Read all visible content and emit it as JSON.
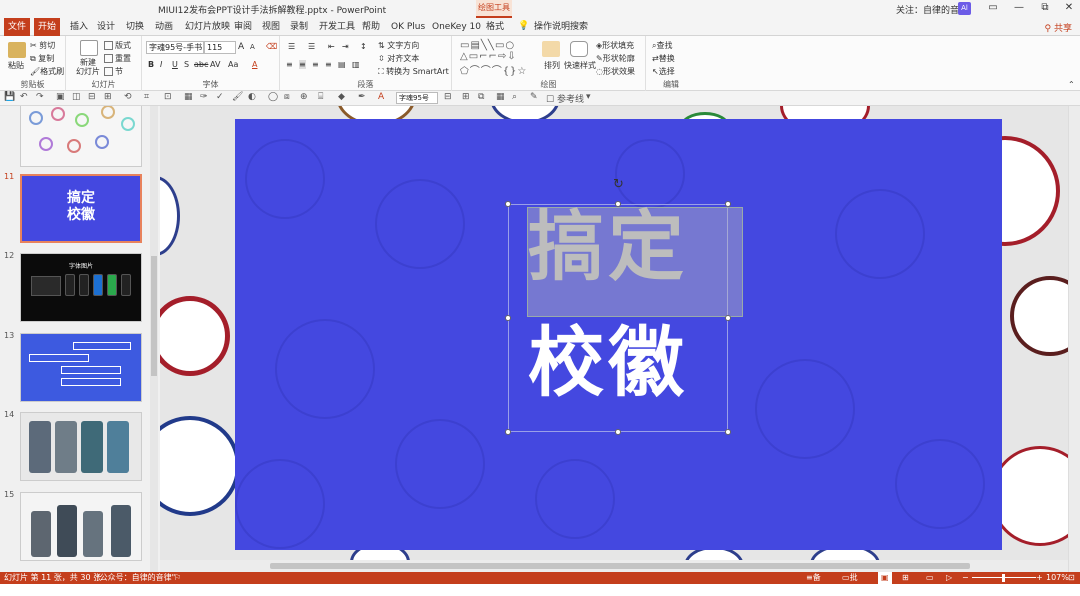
{
  "window": {
    "title": "MIUI12发布会PPT设计手法拆解教程.pptx  -  PowerPoint",
    "context_tab_group": "绘图工具",
    "follow_text": "关注：自律的音律",
    "avatar_text": "Al",
    "win_minimize": "—",
    "win_restore": "⧉",
    "win_close": "✕"
  },
  "tabs": [
    "文件",
    "开始",
    "插入",
    "设计",
    "切换",
    "动画",
    "幻灯片放映",
    "审阅",
    "视图",
    "录制",
    "开发工具",
    "帮助",
    "OK Plus",
    "OneKey 10",
    "格式"
  ],
  "tell_me": "操作说明搜索",
  "share_label": "共享",
  "ribbon": {
    "clipboard": {
      "paste": "粘贴",
      "cut": "剪切",
      "copy": "复制",
      "format_painter": "格式刷",
      "label": "剪贴板"
    },
    "slides": {
      "new_slide": "新建\n幻灯片",
      "layout": "版式",
      "reset": "重置",
      "section": "节",
      "label": "幻灯片"
    },
    "font": {
      "font_name": "字魂95号-手书",
      "font_size": "115",
      "label": "字体",
      "bold": "B",
      "italic": "I",
      "underline": "U",
      "strike": "S",
      "abc": "abc",
      "spacing": "AV",
      "case": "Aa",
      "grow": "A",
      "shrink": "A",
      "font_color": "A"
    },
    "paragraph": {
      "text_direction": "文字方向",
      "align_text": "对齐文本",
      "smartart": "转换为 SmartArt",
      "label": "段落"
    },
    "drawing": {
      "arrange": "排列",
      "quick_styles": "快速样式",
      "shape_fill": "形状填充",
      "shape_outline": "形状轮廓",
      "shape_effects": "形状效果",
      "label": "绘图"
    },
    "editing": {
      "find": "查找",
      "replace": "替换",
      "select": "选择",
      "label": "编辑"
    }
  },
  "qat": {
    "font_select": "字魂95号",
    "guides_label": "参考线"
  },
  "thumbnails": [
    {
      "num": "11",
      "title_line1": "搞定",
      "title_line2": "校徽",
      "current": true
    },
    {
      "num": "12",
      "title": "字体图片",
      "current": false
    },
    {
      "num": "13",
      "current": false
    },
    {
      "num": "14",
      "current": false
    },
    {
      "num": "15",
      "current": false
    }
  ],
  "slide": {
    "line1": "搞定",
    "line2": "校徽",
    "rotate_handle": "↻"
  },
  "status": {
    "slide_info": "幻灯片 第 11 张，共 30 张",
    "watermark": "\"公众号：自律的音律\"",
    "notes": "备注",
    "comments": "批注",
    "zoom": "107%"
  },
  "colors": {
    "accent": "#c43e1c",
    "slide_bg": "#4448e0"
  }
}
